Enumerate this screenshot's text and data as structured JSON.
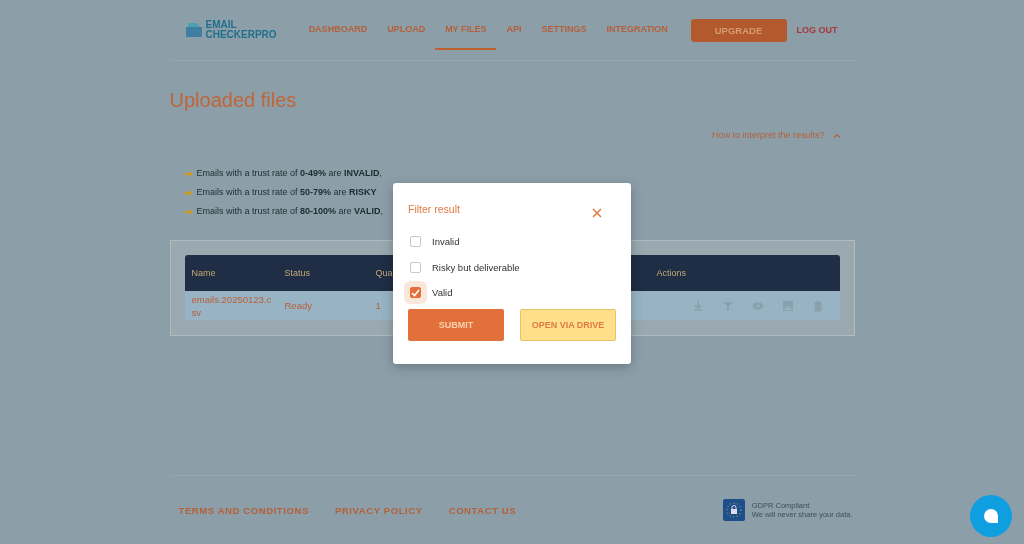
{
  "logo": {
    "line_1": "EMAIL",
    "line_2": "CHECKERPRO"
  },
  "nav": [
    {
      "label": "DASHBOARD",
      "selected": false
    },
    {
      "label": "UPLOAD",
      "selected": false
    },
    {
      "label": "MY FILES",
      "selected": true
    },
    {
      "label": "API",
      "selected": false
    },
    {
      "label": "SETTINGS",
      "selected": false
    },
    {
      "label": "INTEGRATION",
      "selected": false
    }
  ],
  "upgrade_button": "UPGRADE",
  "logout": "LOG OUT",
  "page_title": "Uploaded files",
  "help_toggle": {
    "label": "How to interpret the results?",
    "expanded": true
  },
  "bullets": [
    "Emails with a trust rate of **0-49%** are **INVALID**,",
    "Emails with a trust rate of **50-79%** are **RISKY**",
    "Emails with a trust rate of **80-100%** are **VALID**,"
  ],
  "table": {
    "columns": [
      "Name",
      "Status",
      "Qua",
      "Actions"
    ],
    "rows": [
      {
        "name": "emails.20250123.csv",
        "status": "Ready",
        "quantity": "1"
      }
    ]
  },
  "modal": {
    "title": "Filter result",
    "options": [
      {
        "label": "Invalid",
        "checked": false
      },
      {
        "label": "Risky but deliverable",
        "checked": false
      },
      {
        "label": "Valid",
        "checked": true
      }
    ],
    "buttons": [
      {
        "label": "SUBMIT",
        "kind": "primary"
      },
      {
        "label": "OPEN VIA DRIVE",
        "kind": "secondary"
      }
    ]
  },
  "footer": {
    "links": [
      "TERMS AND CONDITIONS",
      "PRIVACY POLICY",
      "CONTACT US"
    ],
    "gdpr_title": "GDPR Compliant",
    "gdpr_text": "We will never share your data."
  }
}
